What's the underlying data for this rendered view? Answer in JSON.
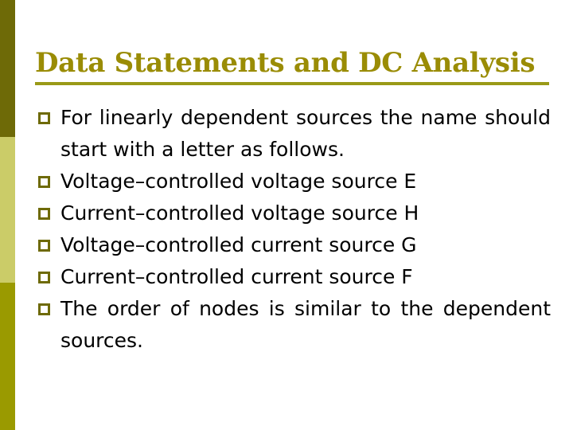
{
  "slide": {
    "background_color": "#ffffff",
    "title": "Data Statements and DC Analysis",
    "title_color": "#9a8c05",
    "rule_color": "#9a9a17",
    "body_text_color": "#000000",
    "bullet_marker_color": "#6e6a07",
    "left_band": {
      "name": "decorative-band",
      "segments": [
        {
          "label": "top",
          "color": "#6e6a07"
        },
        {
          "label": "middle",
          "color": "#cbcc68"
        },
        {
          "label": "bottom",
          "color": "#9a9a00"
        }
      ]
    },
    "bullets": [
      {
        "marker": "hollow-square-bullet",
        "text": "For linearly dependent sources the name should start with a letter as follows.",
        "lines": 2
      },
      {
        "marker": "hollow-square-bullet",
        "text": "Voltage–controlled voltage source   E",
        "lines": 1
      },
      {
        "marker": "hollow-square-bullet",
        "text": "Current–controlled voltage source   H",
        "lines": 1
      },
      {
        "marker": "hollow-square-bullet",
        "text": "Voltage–controlled current source   G",
        "lines": 1
      },
      {
        "marker": "hollow-square-bullet",
        "text": "Current–controlled current source   F",
        "lines": 1
      },
      {
        "marker": "hollow-square-bullet",
        "text": "The order of nodes is similar to the dependent sources.",
        "lines": 2
      }
    ]
  }
}
